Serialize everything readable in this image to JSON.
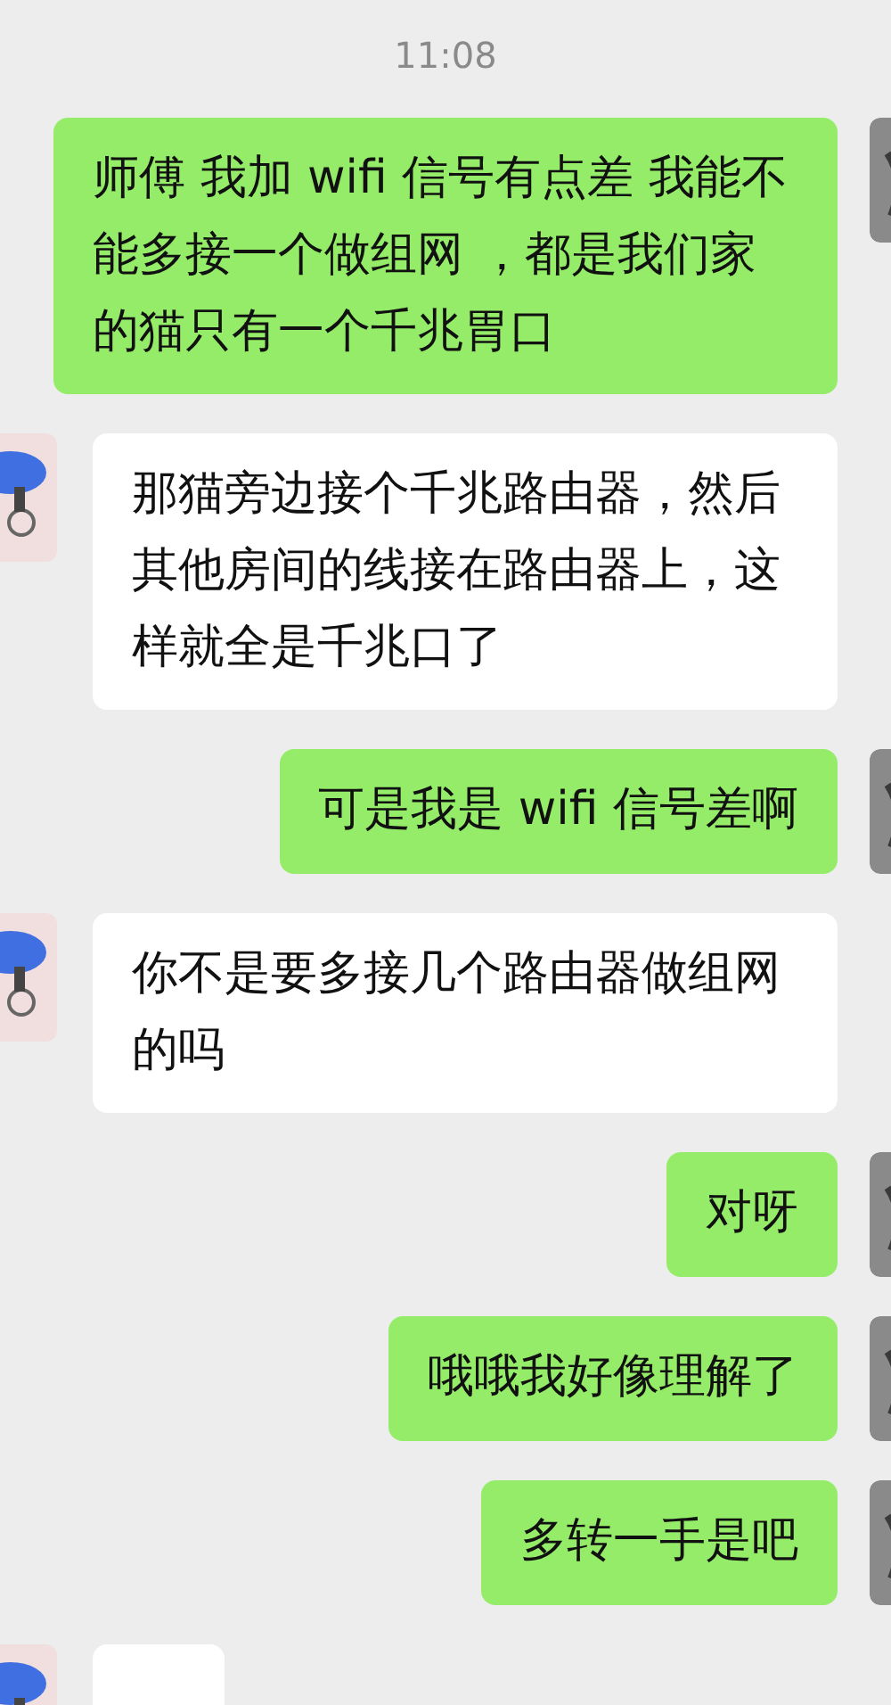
{
  "timestamp": "11:08",
  "messages": [
    {
      "kind": "sent",
      "text": "师傅  我加 wifi 信号有点差 我能不能多接一个做组网 ，都是我们家的猫只有一个千兆胃口"
    },
    {
      "kind": "received",
      "text": "那猫旁边接个千兆路由器，然后其他房间的线接在路由器上，这样就全是千兆口了"
    },
    {
      "kind": "sent",
      "text": "可是我是 wifi 信号差啊"
    },
    {
      "kind": "received",
      "text": "你不是要多接几个路由器做组网的吗"
    },
    {
      "kind": "sent",
      "text": "对呀"
    },
    {
      "kind": "sent",
      "text": "哦哦我好像理解了"
    },
    {
      "kind": "sent",
      "text": "多转一手是吧"
    },
    {
      "kind": "received"
    }
  ]
}
